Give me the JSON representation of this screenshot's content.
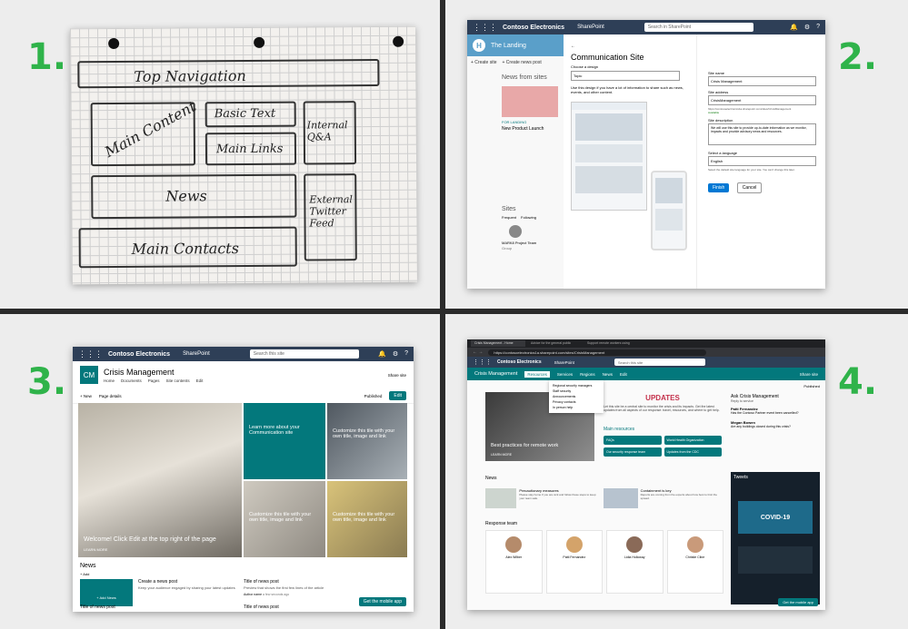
{
  "steps": [
    "1.",
    "2.",
    "3.",
    "4."
  ],
  "sketch": {
    "top_nav": "Top Navigation",
    "main_content": "Main Content",
    "basic_text": "Basic Text",
    "main_links": "Main Links",
    "internal_qa": "Internal Q&A",
    "news": "News",
    "external_twitter": "External Twitter Feed",
    "main_contacts": "Main Contacts"
  },
  "panel2": {
    "brand": "Contoso Electronics",
    "app": "SharePoint",
    "search": "Search in SharePoint",
    "hub_site": "The Landing",
    "create_site": "+ Create site",
    "create_news": "+ Create news post",
    "news_from_sites": "News from sites",
    "news_tag": "FOR LANDING",
    "news_title": "New Product Launch",
    "sites_heading": "Sites",
    "sites_tab1": "Frequent",
    "sites_tab2": "Following",
    "site_name": "MARK8 Project Team",
    "site_type": "Group",
    "dialog_title": "Communication Site",
    "choose_design": "Choose a design",
    "design_value": "Topic",
    "design_desc": "Use this design if you have a lot of information to share such as news, events, and other content.",
    "site_name_label": "Site name",
    "site_name_value": "Crisis Management",
    "site_address_label": "Site address",
    "site_address_value": "CrisisManagement",
    "site_url": "https://contosoelectronics1a.sharepoint.com/sites/CrisisManagement",
    "available": "Available",
    "site_desc_label": "Site description",
    "site_desc_value": "We will use this site to provide up-to-date information as we monitor, impacts and provide advisory news and resources.",
    "language_label": "Select a language",
    "language_value": "English",
    "language_note": "Select the default site language for your site. You can't change this later.",
    "finish": "Finish",
    "cancel": "Cancel"
  },
  "panel3": {
    "brand": "Contoso Electronics",
    "app": "SharePoint",
    "search": "Search this site",
    "logo": "CM",
    "site_title": "Crisis Management",
    "nav": [
      "Home",
      "Documents",
      "Pages",
      "Site contents",
      "Edit"
    ],
    "share": "Share site",
    "new": "+ New",
    "page_details": "Page details",
    "published": "Published",
    "edit": "Edit",
    "hero_main": "Welcome! Click Edit at the top right of the page",
    "learn_more": "LEARN MORE",
    "tile_learn": "Learn more about your Communication site",
    "tile_custom": "Customize this tile with your own title, image and link",
    "news_heading": "News",
    "add": "+ Add",
    "add_news": "+ Add News",
    "create_news_title": "Create a news post",
    "create_news_desc": "Keep your audience engaged by sharing your latest updates",
    "news_post_title": "Title of news post",
    "news_post_desc": "Preview that shows the first few lines of the article",
    "author": "Author name",
    "time": "a few seconds ago",
    "get_app": "Get the mobile app"
  },
  "panel4": {
    "browser_tab1": "Crisis Management - Home",
    "browser_tab2": "Advice for the general public",
    "browser_tab3": "Support remote workers using",
    "url": "https://contosoelectronics1a.sharepoint.com/sites/CrisisManagement",
    "brand": "Contoso Electronics",
    "app": "SharePoint",
    "search": "Search this site",
    "site_title": "Crisis Management",
    "nav": [
      "Resources",
      "Services",
      "Regions",
      "News",
      "Edit"
    ],
    "menu": [
      "Regional security managers",
      "Staff security",
      "Announcements",
      "Privacy contacts",
      "In person help"
    ],
    "share": "Share site",
    "published": "Published",
    "hero_caption": "Best practices for remote work",
    "learn_more": "LEARN MORE",
    "updates": "UPDATES",
    "updates_desc": "Let this site be a central site to monitor the crisis and its impacts. Get the latest updates from all aspects of our response: travel, resources, and where to get help.",
    "main_resources": "Main resources",
    "resources": [
      "FAQs",
      "World Health Organization",
      "Our security response team",
      "Updates from the CDC"
    ],
    "ask_heading": "Ask Crisis Management",
    "reply": "Reply to service",
    "person1": "Patti Fernandez",
    "question1": "Has the Contoso Partner event been cancelled?",
    "person2": "Megan Bowen",
    "question2": "Are any buildings closed during this crisis?",
    "news_heading": "News",
    "news1_title": "Precautionary measures",
    "news1_desc": "Please stay home if you are sick and follow these steps to keep your team safe.",
    "news2_title": "Containment is key",
    "news2_desc": "Reports are coming from the experts about how best to limit the spread.",
    "response_team": "Response team",
    "team": [
      "Alex Wilber",
      "Patti Fernandez",
      "Lidia Holloway",
      "Christie Cline"
    ],
    "tweets": "Tweets",
    "covid": "COVID-19",
    "get_app": "Get the mobile app"
  },
  "colors": {
    "background": "#2b2b2b",
    "step_green": "#2fb34a",
    "suitebar": "#2e3f57",
    "teal": "#03787c",
    "finish_blue": "#0078d4"
  }
}
